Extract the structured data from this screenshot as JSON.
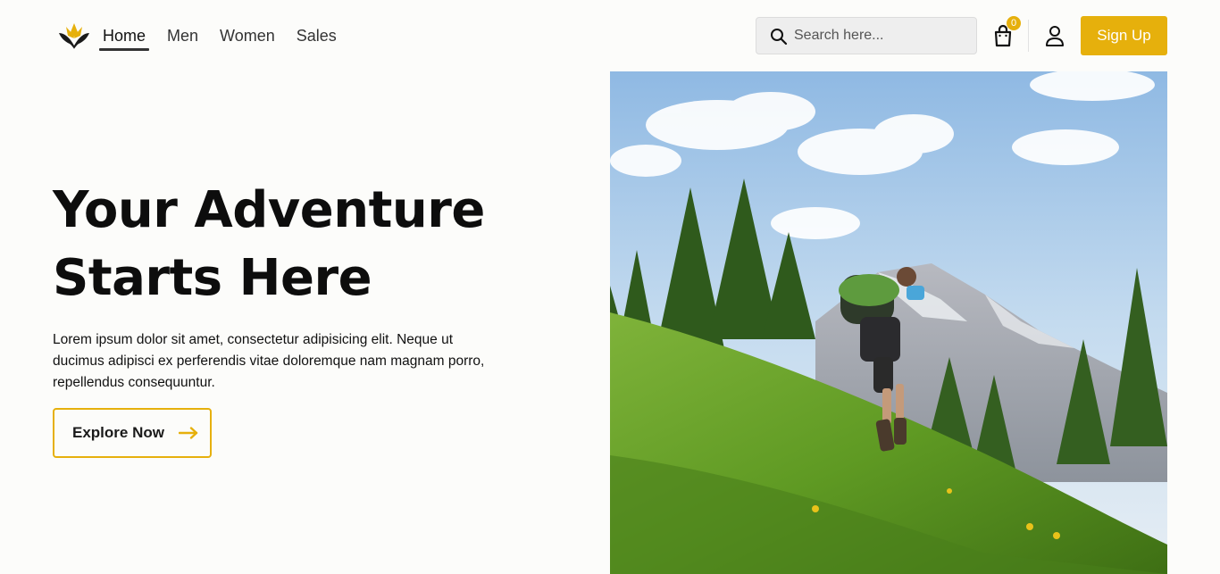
{
  "header": {
    "logo_name": "lotus-logo",
    "nav": [
      {
        "label": "Home",
        "active": true
      },
      {
        "label": "Men",
        "active": false
      },
      {
        "label": "Women",
        "active": false
      },
      {
        "label": "Sales",
        "active": false
      }
    ],
    "search": {
      "placeholder": "Search here...",
      "value": ""
    },
    "cart_count": "0",
    "signup_label": "Sign Up"
  },
  "hero": {
    "title_line1": "Your Adventure",
    "title_line2": "Starts Here",
    "text": "Lorem ipsum dolor sit amet, consectetur adipisicing elit. Neque ut ducimus adipisci ex perferendis vitae doloremque nam magnam porro, repellendus consequuntur.",
    "cta_label": "Explore Now",
    "image_alt": "hiker-on-grassy-mountain-slope"
  },
  "colors": {
    "accent": "#e6b00c",
    "background": "#fcfcfa",
    "text": "#111111"
  }
}
